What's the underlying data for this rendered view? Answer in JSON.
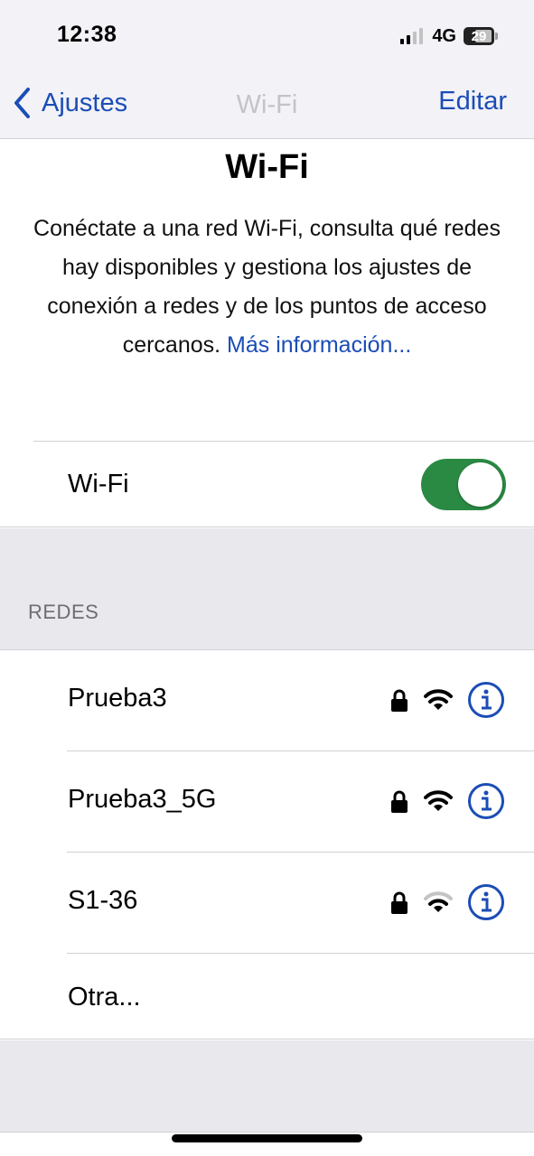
{
  "status_bar": {
    "time": "12:38",
    "network": "4G",
    "battery": "29"
  },
  "nav": {
    "back_label": "Ajustes",
    "title": "Wi-Fi",
    "edit_label": "Editar"
  },
  "header": {
    "title": "Wi-Fi",
    "description": "Conéctate a una red Wi-Fi, consulta qué redes hay disponibles y gestiona los ajustes de conexión a redes y de los puntos de acceso cercanos.",
    "link": "Más información..."
  },
  "wifi_toggle": {
    "label": "Wi-Fi",
    "enabled": true
  },
  "networks": {
    "section_header": "REDES",
    "items": [
      {
        "name": "Prueba3",
        "locked": true,
        "signal_bars": 3
      },
      {
        "name": "Prueba3_5G",
        "locked": true,
        "signal_bars": 3
      },
      {
        "name": "S1-36",
        "locked": true,
        "signal_bars": 2
      }
    ],
    "other_label": "Otra..."
  },
  "colors": {
    "accent": "#1b4db5",
    "toggle_on": "#2a8a44",
    "grouped_background": "#e8e8ed",
    "nav_background": "#f2f2f7"
  }
}
